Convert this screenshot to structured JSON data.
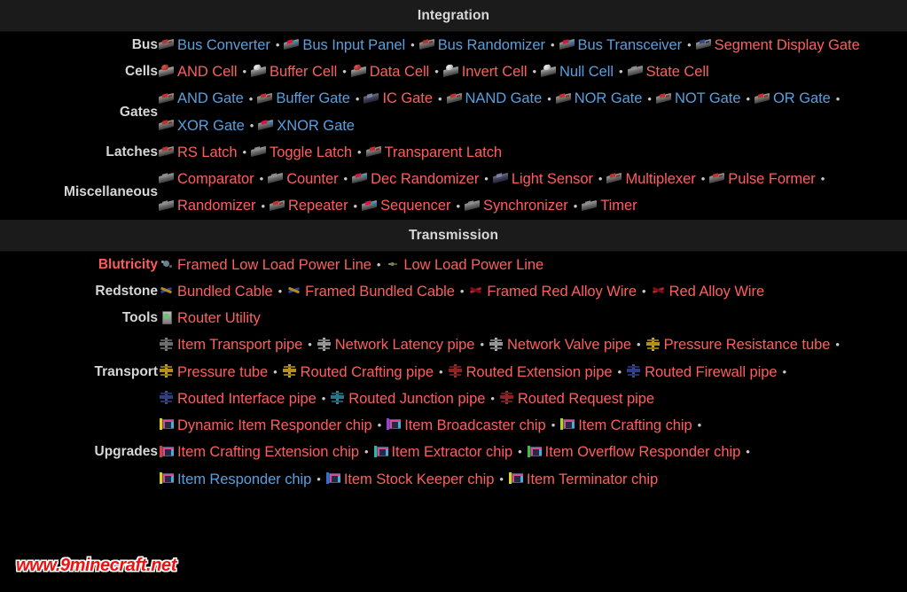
{
  "colors": {
    "background": "#000000",
    "header_bar": "#1b1b1b",
    "header_text": "#d8d8d8",
    "label_text": "#d6d6d6",
    "label_accent": "#ff5b5b",
    "link_red": "#ff5e5e",
    "link_blue": "#5a9fdd",
    "separator": "#c9c9c9",
    "watermark": "#ee1111"
  },
  "watermark": {
    "text": "www.9minecraft.net"
  },
  "sections": [
    {
      "title": "Integration",
      "rows": [
        {
          "label": "Bus",
          "label_style": "normal",
          "items": [
            {
              "name": "Bus Converter",
              "color": "blue",
              "icon": "gate-bus-converter-icon",
              "icon_class": "spr gate"
            },
            {
              "name": "Bus Input Panel",
              "color": "blue",
              "icon": "gate-bus-input-panel-icon",
              "icon_class": "spr gate colorful"
            },
            {
              "name": "Bus Randomizer",
              "color": "blue",
              "icon": "gate-bus-randomizer-icon",
              "icon_class": "spr gate"
            },
            {
              "name": "Bus Transceiver",
              "color": "blue",
              "icon": "gate-bus-transceiver-icon",
              "icon_class": "spr gate colorful"
            },
            {
              "name": "Segment Display Gate",
              "color": "red",
              "icon": "gate-segment-display-icon",
              "icon_class": "spr gate blue"
            }
          ]
        },
        {
          "label": "Cells",
          "label_style": "normal",
          "items": [
            {
              "name": "AND Cell",
              "color": "red",
              "icon": "cell-and-icon",
              "icon_class": "spr cell"
            },
            {
              "name": "Buffer Cell",
              "color": "red",
              "icon": "cell-buffer-icon",
              "icon_class": "spr cell white"
            },
            {
              "name": "Data Cell",
              "color": "red",
              "icon": "cell-data-icon",
              "icon_class": "spr cell"
            },
            {
              "name": "Invert Cell",
              "color": "red",
              "icon": "cell-invert-icon",
              "icon_class": "spr cell white"
            },
            {
              "name": "Null Cell",
              "color": "blue",
              "icon": "cell-null-icon",
              "icon_class": "spr cell white"
            },
            {
              "name": "State Cell",
              "color": "red",
              "icon": "cell-state-icon",
              "icon_class": "spr gate plain"
            }
          ]
        },
        {
          "label": "Gates",
          "label_style": "normal",
          "items": [
            {
              "name": "AND Gate",
              "color": "blue",
              "icon": "gate-and-icon",
              "icon_class": "spr gate"
            },
            {
              "name": "Buffer Gate",
              "color": "blue",
              "icon": "gate-buffer-icon",
              "icon_class": "spr gate"
            },
            {
              "name": "IC Gate",
              "color": "red",
              "icon": "gate-ic-icon",
              "icon_class": "spr gate dark"
            },
            {
              "name": "NAND Gate",
              "color": "blue",
              "icon": "gate-nand-icon",
              "icon_class": "spr gate"
            },
            {
              "name": "NOR Gate",
              "color": "blue",
              "icon": "gate-nor-icon",
              "icon_class": "spr gate"
            },
            {
              "name": "NOT Gate",
              "color": "blue",
              "icon": "gate-not-icon",
              "icon_class": "spr gate"
            },
            {
              "name": "OR Gate",
              "color": "blue",
              "icon": "gate-or-icon",
              "icon_class": "spr gate"
            },
            {
              "name": "XOR Gate",
              "color": "blue",
              "icon": "gate-xor-icon",
              "icon_class": "spr gate"
            },
            {
              "name": "XNOR Gate",
              "color": "blue",
              "icon": "gate-xnor-icon",
              "icon_class": "spr gate colorful"
            }
          ]
        },
        {
          "label": "Latches",
          "label_style": "normal",
          "items": [
            {
              "name": "RS Latch",
              "color": "red",
              "icon": "latch-rs-icon",
              "icon_class": "spr gate"
            },
            {
              "name": "Toggle Latch",
              "color": "red",
              "icon": "latch-toggle-icon",
              "icon_class": "spr gate plain"
            },
            {
              "name": "Transparent Latch",
              "color": "red",
              "icon": "latch-transparent-icon",
              "icon_class": "spr gate"
            }
          ]
        },
        {
          "label": "Miscellaneous",
          "label_style": "normal",
          "items": [
            {
              "name": "Comparator",
              "color": "red",
              "icon": "misc-comparator-icon",
              "icon_class": "spr gate plain"
            },
            {
              "name": "Counter",
              "color": "red",
              "icon": "misc-counter-icon",
              "icon_class": "spr gate plain"
            },
            {
              "name": "Dec Randomizer",
              "color": "red",
              "icon": "misc-dec-randomizer-icon",
              "icon_class": "spr gate colorful"
            },
            {
              "name": "Light Sensor",
              "color": "red",
              "icon": "misc-light-sensor-icon",
              "icon_class": "spr gate dark"
            },
            {
              "name": "Multiplexer",
              "color": "red",
              "icon": "misc-multiplexer-icon",
              "icon_class": "spr gate"
            },
            {
              "name": "Pulse Former",
              "color": "red",
              "icon": "misc-pulse-former-icon",
              "icon_class": "spr gate"
            },
            {
              "name": "Randomizer",
              "color": "red",
              "icon": "misc-randomizer-icon",
              "icon_class": "spr gate plain"
            },
            {
              "name": "Repeater",
              "color": "red",
              "icon": "misc-repeater-icon",
              "icon_class": "spr gate"
            },
            {
              "name": "Sequencer",
              "color": "red",
              "icon": "misc-sequencer-icon",
              "icon_class": "spr gate colorful"
            },
            {
              "name": "Synchronizer",
              "color": "red",
              "icon": "misc-synchronizer-icon",
              "icon_class": "spr gate plain"
            },
            {
              "name": "Timer",
              "color": "red",
              "icon": "misc-timer-icon",
              "icon_class": "spr gate plain"
            }
          ]
        }
      ]
    },
    {
      "title": "Transmission",
      "rows": [
        {
          "label": "Blutricity",
          "label_style": "accent",
          "items": [
            {
              "name": "Framed Low Load Power Line",
              "color": "red",
              "icon": "power-line-framed-icon",
              "icon_class": "spr power"
            },
            {
              "name": "Low Load Power Line",
              "color": "red",
              "icon": "power-line-icon",
              "icon_class": "spr power tiny"
            }
          ]
        },
        {
          "label": "Redstone",
          "label_style": "normal",
          "items": [
            {
              "name": "Bundled Cable",
              "color": "red",
              "icon": "bundled-cable-icon",
              "icon_class": "spr wire bundle"
            },
            {
              "name": "Framed Bundled Cable",
              "color": "red",
              "icon": "framed-bundled-cable-icon",
              "icon_class": "spr wire bundle"
            },
            {
              "name": "Framed Red Alloy Wire",
              "color": "red",
              "icon": "framed-red-alloy-wire-icon",
              "icon_class": "spr wire"
            },
            {
              "name": "Red Alloy Wire",
              "color": "red",
              "icon": "red-alloy-wire-icon",
              "icon_class": "spr wire"
            }
          ]
        },
        {
          "label": "Tools",
          "label_style": "normal",
          "items": [
            {
              "name": "Router Utility",
              "color": "red",
              "icon": "router-utility-icon",
              "icon_class": "spr tool"
            }
          ]
        },
        {
          "label": "Transport",
          "label_style": "normal",
          "items": [
            {
              "name": "Item Transport pipe",
              "color": "red",
              "icon": "pipe-item-transport-icon",
              "icon_class": "spr pipe"
            },
            {
              "name": "Network Latency pipe",
              "color": "red",
              "icon": "pipe-network-latency-icon",
              "icon_class": "spr pipe ltgray"
            },
            {
              "name": "Network Valve pipe",
              "color": "red",
              "icon": "pipe-network-valve-icon",
              "icon_class": "spr pipe ltgray"
            },
            {
              "name": "Pressure Resistance tube",
              "color": "red",
              "icon": "pipe-pressure-resistance-icon",
              "icon_class": "spr pipe gold"
            },
            {
              "name": "Pressure tube",
              "color": "red",
              "icon": "pipe-pressure-icon",
              "icon_class": "spr pipe gold"
            },
            {
              "name": "Routed Crafting pipe",
              "color": "red",
              "icon": "pipe-routed-crafting-icon",
              "icon_class": "spr pipe gold"
            },
            {
              "name": "Routed Extension pipe",
              "color": "red",
              "icon": "pipe-routed-extension-icon",
              "icon_class": "spr pipe crimson"
            },
            {
              "name": "Routed Firewall pipe",
              "color": "red",
              "icon": "pipe-routed-firewall-icon",
              "icon_class": "spr pipe navy"
            },
            {
              "name": "Routed Interface pipe",
              "color": "red",
              "icon": "pipe-routed-interface-icon",
              "icon_class": "spr pipe navy"
            },
            {
              "name": "Routed Junction pipe",
              "color": "red",
              "icon": "pipe-routed-junction-icon",
              "icon_class": "spr pipe teal"
            },
            {
              "name": "Routed Request pipe",
              "color": "red",
              "icon": "pipe-routed-request-icon",
              "icon_class": "spr pipe crimson"
            }
          ]
        },
        {
          "label": "Upgrades",
          "label_style": "normal",
          "items": [
            {
              "name": "Dynamic Item Responder chip",
              "color": "red",
              "icon": "chip-dynamic-item-responder-icon",
              "icon_class": "spr chip yellow"
            },
            {
              "name": "Item Broadcaster chip",
              "color": "red",
              "icon": "chip-item-broadcaster-icon",
              "icon_class": "spr chip purple"
            },
            {
              "name": "Item Crafting chip",
              "color": "red",
              "icon": "chip-item-crafting-icon",
              "icon_class": "spr chip lime"
            },
            {
              "name": "Item Crafting Extension chip",
              "color": "red",
              "icon": "chip-item-crafting-extension-icon",
              "icon_class": "spr chip red"
            },
            {
              "name": "Item Extractor chip",
              "color": "red",
              "icon": "chip-item-extractor-icon",
              "icon_class": "spr chip teal"
            },
            {
              "name": "Item Overflow Responder chip",
              "color": "red",
              "icon": "chip-item-overflow-responder-icon",
              "icon_class": "spr chip green"
            },
            {
              "name": "Item Responder chip",
              "color": "blue",
              "icon": "chip-item-responder-icon",
              "icon_class": "spr chip yellow"
            },
            {
              "name": "Item Stock Keeper chip",
              "color": "red",
              "icon": "chip-item-stock-keeper-icon",
              "icon_class": "spr chip blue"
            },
            {
              "name": "Item Terminator chip",
              "color": "red",
              "icon": "chip-item-terminator-icon",
              "icon_class": "spr chip yellow"
            }
          ]
        }
      ]
    }
  ]
}
